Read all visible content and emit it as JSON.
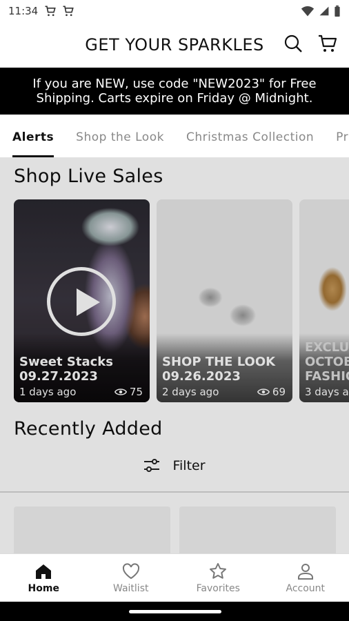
{
  "status_bar": {
    "time": "11:34",
    "icons": [
      "cart-notification-icon",
      "cart-notification-icon",
      "wifi-icon",
      "signal-icon",
      "battery-icon"
    ]
  },
  "header": {
    "title": "GET YOUR SPARKLES",
    "icons": [
      "search-icon",
      "cart-icon"
    ]
  },
  "promo": {
    "text": "If you are NEW, use code \"NEW2023\" for Free Shipping. Carts expire on Friday @ Midnight."
  },
  "tabs": [
    {
      "label": "Alerts",
      "active": true
    },
    {
      "label": "Shop the Look",
      "active": false
    },
    {
      "label": "Christmas Collection",
      "active": false
    },
    {
      "label": "Pr",
      "active": false
    }
  ],
  "live_sales": {
    "title": "Shop Live Sales",
    "cards": [
      {
        "title": "Sweet Stacks\n09.27.2023",
        "ago": "1 days ago",
        "views": "75",
        "has_play": true
      },
      {
        "title": "SHOP THE LOOK\n09.26.2023",
        "ago": "2 days ago",
        "views": "69",
        "has_play": false
      },
      {
        "title": "EXCLU\nOCTOB\nFASHIO",
        "ago": "3 days a",
        "views": "",
        "has_play": false
      }
    ]
  },
  "recently_added": {
    "title": "Recently Added",
    "filter_label": "Filter"
  },
  "bottom_nav": [
    {
      "label": "Home",
      "icon": "home-icon",
      "active": true
    },
    {
      "label": "Waitlist",
      "icon": "heart-icon",
      "active": false
    },
    {
      "label": "Favorites",
      "icon": "star-icon",
      "active": false
    },
    {
      "label": "Account",
      "icon": "person-icon",
      "active": false
    }
  ],
  "colors": {
    "accent": "#111111",
    "promo_bg": "#000000",
    "inactive": "#888888"
  }
}
